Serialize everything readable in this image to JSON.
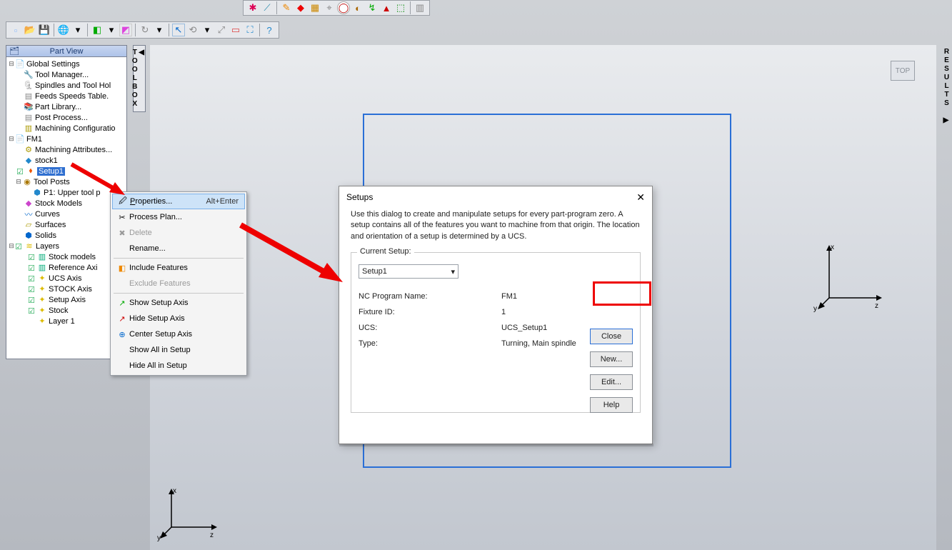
{
  "partview": {
    "title": "Part View",
    "global": "Global Settings",
    "items": {
      "tool_manager": "Tool Manager...",
      "spindles": "Spindles and Tool Hol",
      "feeds": "Feeds Speeds Table.",
      "part_library": "Part Library...",
      "post_process": "Post Process...",
      "machining_config": "Machining Configuratio"
    },
    "fm1": "FM1",
    "machining_attr": "Machining Attributes...",
    "stock1": "stock1",
    "setup1": "Setup1",
    "tool_posts": "Tool Posts",
    "p1": "P1: Upper tool p",
    "stock_models": "Stock Models",
    "curves": "Curves",
    "surfaces": "Surfaces",
    "solids": "Solids",
    "layers": "Layers",
    "layer_items": {
      "stock_models_l": "Stock models",
      "reference_axis": "Reference Axi",
      "ucs_axis": "UCS Axis",
      "stock_axis": "STOCK Axis",
      "setup_axis": "Setup Axis",
      "stock": "Stock",
      "layer1": "Layer 1"
    }
  },
  "toolbox": "TOOLBOX",
  "results": "RESULTS",
  "top_badge": "TOP",
  "context_menu": {
    "properties": "Properties...",
    "properties_accel": "Alt+Enter",
    "process_plan": "Process Plan...",
    "delete": "Delete",
    "rename": "Rename...",
    "include": "Include Features",
    "exclude": "Exclude Features",
    "show_axis": "Show Setup Axis",
    "hide_axis": "Hide Setup Axis",
    "center_axis": "Center Setup Axis",
    "show_all": "Show All in Setup",
    "hide_all": "Hide All in Setup"
  },
  "dialog": {
    "title": "Setups",
    "desc": "Use this dialog to create and manipulate setups for every part-program zero. A setup contains all of the features you want to machine from that origin. The location and orientation of a setup is determined by a UCS.",
    "legend": "Current Setup:",
    "combo_value": "Setup1",
    "nc_program_k": "NC Program Name:",
    "nc_program_v": "FM1",
    "fixture_k": "Fixture ID:",
    "fixture_v": "1",
    "ucs_k": "UCS:",
    "ucs_v": "UCS_Setup1",
    "type_k": "Type:",
    "type_v": "Turning, Main spindle",
    "close": "Close",
    "new": "New...",
    "edit": "Edit...",
    "help": "Help"
  },
  "axes": {
    "x": "x",
    "y": "y",
    "z": "z"
  }
}
